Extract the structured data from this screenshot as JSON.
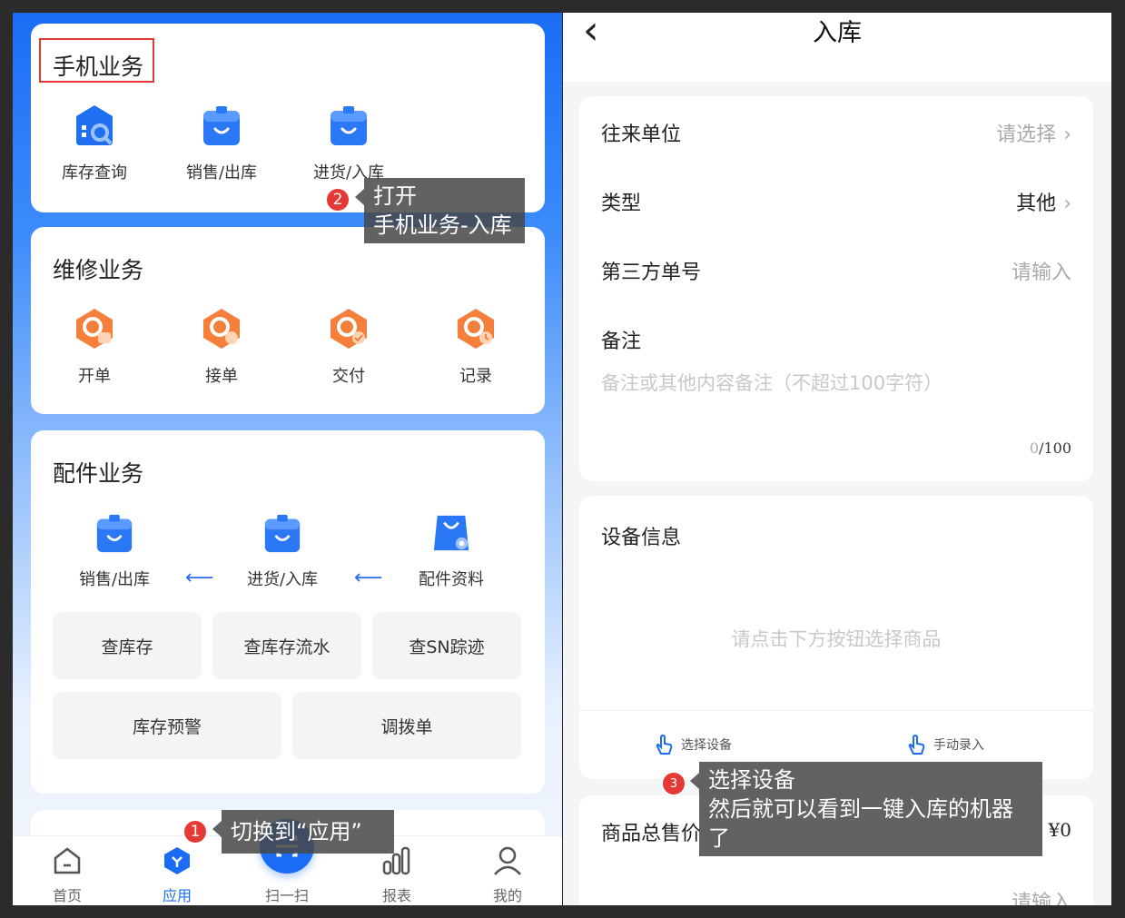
{
  "left": {
    "phone_section": {
      "title": "手机业务",
      "items": [
        {
          "label": "库存查询",
          "icon": "inventory-search-icon"
        },
        {
          "label": "销售/出库",
          "icon": "sales-box-icon"
        },
        {
          "label": "进货/入库",
          "icon": "stock-in-box-icon"
        }
      ]
    },
    "repair_section": {
      "title": "维修业务",
      "items": [
        {
          "label": "开单",
          "icon": "open-order-icon"
        },
        {
          "label": "接单",
          "icon": "accept-order-icon"
        },
        {
          "label": "交付",
          "icon": "deliver-icon"
        },
        {
          "label": "记录",
          "icon": "record-icon"
        }
      ]
    },
    "parts_section": {
      "title": "配件业务",
      "items": [
        {
          "label": "销售/出库",
          "icon": "sales-box-icon"
        },
        {
          "label": "进货/入库",
          "icon": "stock-in-box-icon"
        },
        {
          "label": "配件资料",
          "icon": "parts-bag-icon"
        }
      ],
      "arrow_glyph": "⟵",
      "buttons_row1": [
        "查库存",
        "查库存流水",
        "查SN踪迹"
      ],
      "buttons_row2": [
        "库存预警",
        "调拨单"
      ]
    },
    "tabbar": [
      {
        "label": "首页",
        "icon": "home-icon"
      },
      {
        "label": "应用",
        "icon": "apps-icon"
      },
      {
        "label": "扫一扫",
        "icon": "scan-icon"
      },
      {
        "label": "报表",
        "icon": "report-icon"
      },
      {
        "label": "我的",
        "icon": "profile-icon"
      }
    ]
  },
  "right": {
    "header": {
      "back_glyph": "‹",
      "title": "入库"
    },
    "form": {
      "partner": {
        "label": "往来单位",
        "value": "请选择"
      },
      "type": {
        "label": "类型",
        "value": "其他"
      },
      "third_party": {
        "label": "第三方单号",
        "placeholder": "请输入"
      },
      "remark": {
        "label": "备注",
        "placeholder": "备注或其他内容备注（不超过100字符）",
        "count": "0",
        "max": "/100"
      }
    },
    "device": {
      "title": "设备信息",
      "empty_hint": "请点击下方按钮选择商品",
      "select_label": "选择设备",
      "manual_label": "手动录入"
    },
    "total": {
      "label": "商品总售价",
      "value": "¥0",
      "input_placeholder": "请输入"
    }
  },
  "callouts": {
    "c1": {
      "num": "1",
      "text": "切换到“应用”"
    },
    "c2": {
      "num": "2",
      "line1": "打开",
      "line2": "手机业务-入库"
    },
    "c3": {
      "num": "3",
      "line1": "选择设备",
      "line2": "然后就可以看到一键入库的机器了"
    }
  },
  "colors": {
    "brand": "#1a6cf5",
    "repair_orange": "#f5803b",
    "badge_red": "#e53935"
  }
}
